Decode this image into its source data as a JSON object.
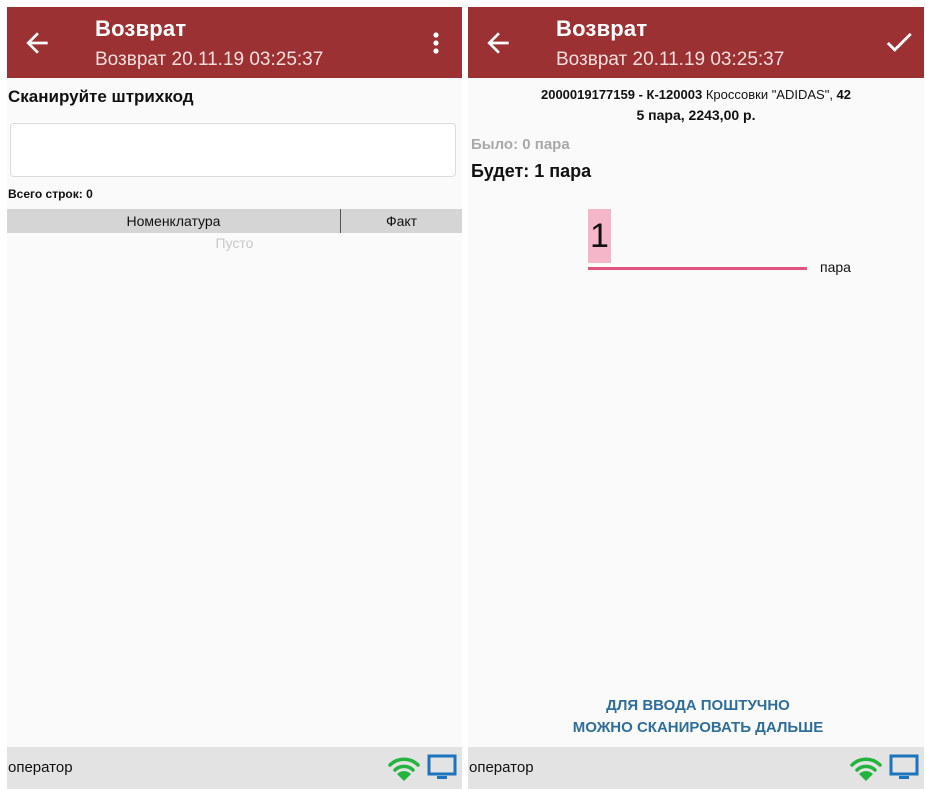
{
  "left": {
    "appbar": {
      "title": "Возврат",
      "subtitle": "Возврат 20.11.19 03:25:37"
    },
    "scan_label": "Сканируйте штрихкод",
    "input_value": "",
    "total_rows": "Всего строк: 0",
    "table": {
      "columns": [
        "Номенклатура",
        "Факт"
      ],
      "empty_text": "Пусто"
    },
    "status": {
      "operator": "оператор"
    }
  },
  "right": {
    "appbar": {
      "title": "Возврат",
      "subtitle": "Возврат 20.11.19 03:25:37"
    },
    "product": {
      "barcode": "2000019177159",
      "sep": " - ",
      "article": "К-120003",
      "name": " Кроссовки \"ADIDAS\", ",
      "size": "42",
      "summary": "5 пара, 2243,00 р."
    },
    "was": "Было: 0 пара",
    "will": "Будет: 1 пара",
    "quantity": "1",
    "unit": "пара",
    "hint_line1": "ДЛЯ ВВОДА ПОШТУЧНО",
    "hint_line2": "МОЖНО СКАНИРОВАТЬ ДАЛЬШЕ",
    "status": {
      "operator": "оператор"
    }
  },
  "colors": {
    "appbar": "#9b3133",
    "accent": "#e0557f",
    "hint": "#2f6e98",
    "wifi": "#22b43c",
    "monitor": "#1e73be"
  },
  "icons": [
    "back-arrow-icon",
    "more-vert-icon",
    "check-icon",
    "wifi-icon",
    "monitor-icon"
  ]
}
